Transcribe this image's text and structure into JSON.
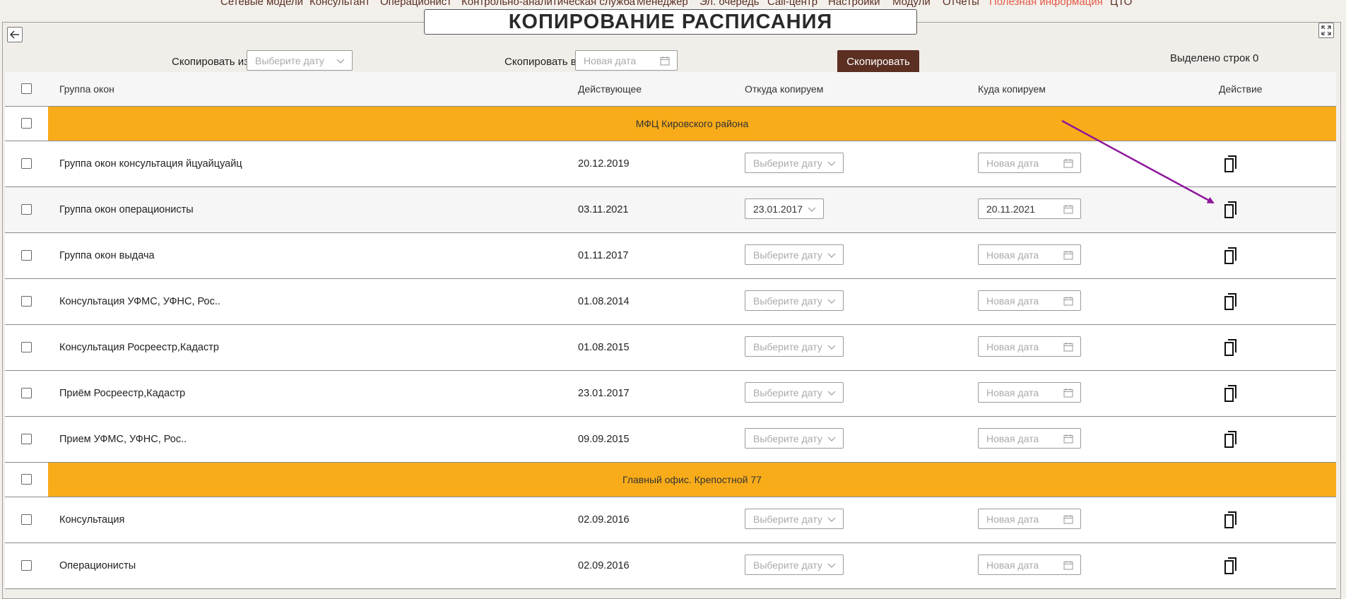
{
  "nav": {
    "items": [
      {
        "label": "Сетевые модели",
        "active": false
      },
      {
        "label": "Консультант",
        "active": false
      },
      {
        "label": "Операционист",
        "active": false
      },
      {
        "label": "Контрольно-аналитическая служба",
        "active": false
      },
      {
        "label": "Менеджер",
        "active": false
      },
      {
        "label": "Эл. очередь",
        "active": false
      },
      {
        "label": "Call-центр",
        "active": false
      },
      {
        "label": "Настройки",
        "active": false
      },
      {
        "label": "Модули",
        "active": false
      },
      {
        "label": "Отчеты",
        "active": false
      },
      {
        "label": "Полезная информация",
        "active": true
      },
      {
        "label": "ЦТО",
        "active": false
      }
    ]
  },
  "page": {
    "title": "КОПИРОВАНИЕ РАСПИСАНИЯ"
  },
  "controls": {
    "copy_from_label": "Скопировать из",
    "copy_from_placeholder": "Выберите дату",
    "copy_to_label": "Скопировать в",
    "copy_to_placeholder": "Новая дата",
    "copy_button": "Скопировать",
    "selected_rows": "Выделено строк 0"
  },
  "table": {
    "headers": {
      "group": "Группа окон",
      "current": "Действующее",
      "from": "Откуда копируем",
      "to": "Куда копируем",
      "action": "Действие"
    },
    "from_placeholder": "Выберите дату",
    "to_placeholder": "Новая дата",
    "sections": [
      {
        "title": "МФЦ Кировского района",
        "rows": [
          {
            "name": "Группа окон консультация йцуайцуайц",
            "current": "20.12.2019",
            "from": "",
            "to": ""
          },
          {
            "name": "Группа окон операционисты",
            "current": "03.11.2021",
            "from": "23.01.2017",
            "to": "20.11.2021"
          },
          {
            "name": "Группа окон выдача",
            "current": "01.11.2017",
            "from": "",
            "to": ""
          },
          {
            "name": "Консультация УФМС, УФНС, Рос..",
            "current": "01.08.2014",
            "from": "",
            "to": ""
          },
          {
            "name": "Консультация Росреестр,Кадастр",
            "current": "01.08.2015",
            "from": "",
            "to": ""
          },
          {
            "name": "Приём Росреестр,Кадастр",
            "current": "23.01.2017",
            "from": "",
            "to": ""
          },
          {
            "name": "Прием УФМС, УФНС, Рос..",
            "current": "09.09.2015",
            "from": "",
            "to": ""
          }
        ]
      },
      {
        "title": "Главный офис. Крепостной 77",
        "rows": [
          {
            "name": "Консультация",
            "current": "02.09.2016",
            "from": "",
            "to": ""
          },
          {
            "name": "Операционисты",
            "current": "02.09.2016",
            "from": "",
            "to": ""
          }
        ]
      }
    ]
  },
  "colors": {
    "brand": "#5b2f22",
    "active_nav": "#e35a47",
    "group_band": "#f8ac1a",
    "annotation_arrow": "#8e169b"
  }
}
